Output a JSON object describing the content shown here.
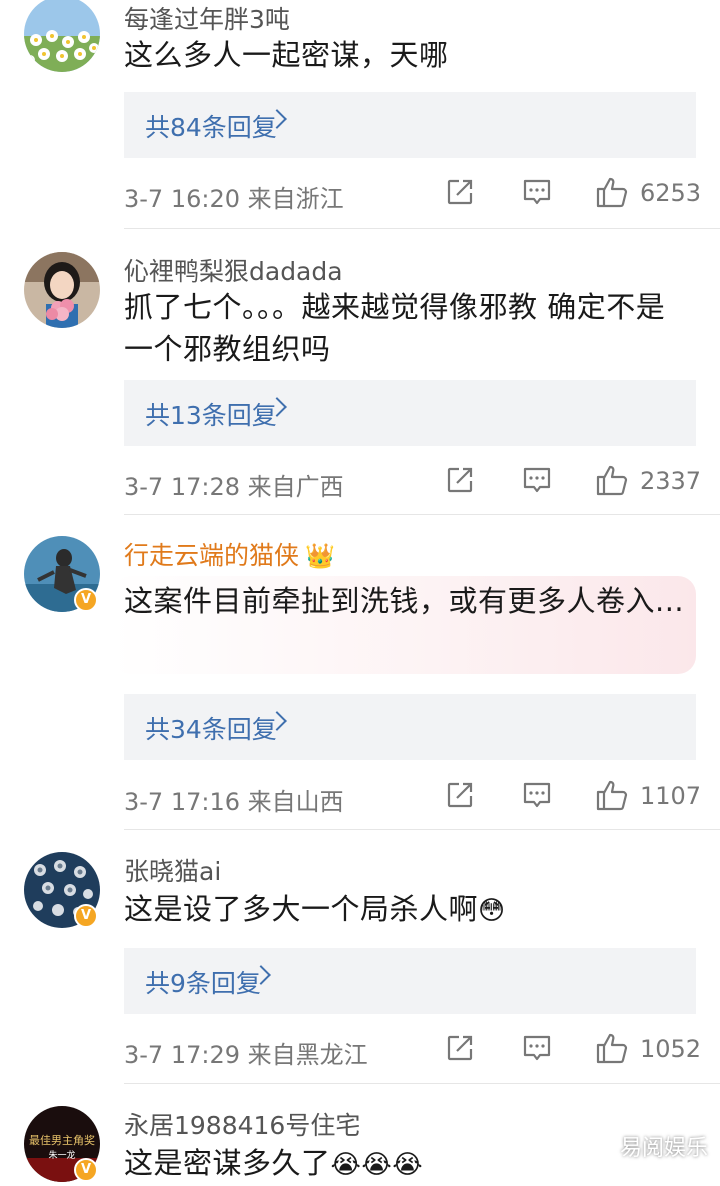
{
  "comments": [
    {
      "username": "每逢过年胖3吨",
      "text": "这么多人一起密谋，天哪",
      "replies": "共84条回复",
      "meta": "3-7 16:20 来自浙江",
      "likes": "6253",
      "verified": false
    },
    {
      "username": "伈裡鸭梨狠dadada",
      "text": "抓了七个。。。越来越觉得像邪教  确定不是一个邪教组织吗",
      "replies": "共13条回复",
      "meta": "3-7 17:28 来自广西",
      "likes": "2337",
      "verified": false
    },
    {
      "username": "行走云端的猫侠",
      "text": "这案件目前牵扯到洗钱，或有更多人卷入...",
      "replies": "共34条回复",
      "meta": "3-7 17:16 来自山西",
      "likes": "1107",
      "verified": true
    },
    {
      "username": "张晓猫ai",
      "text": "这是设了多大一个局杀人啊",
      "replies": "共9条回复",
      "meta": "3-7 17:29 来自黑龙江",
      "likes": "1052",
      "verified": true
    },
    {
      "username": "永居1988416号住宅",
      "text": "这是密谋多久了",
      "verified": true
    }
  ],
  "avatar5_text": [
    "最佳男主角奖",
    "朱一龙"
  ],
  "watermark": "易阅娱乐",
  "icons": {
    "share": "share-icon",
    "comment": "comment-icon",
    "like": "thumbs-up-icon",
    "crown": "crown-icon",
    "verified": "verified-badge-icon"
  },
  "colors": {
    "link": "#3f6fae",
    "vip_name": "#e07a1b",
    "badge": "#f5a623"
  }
}
